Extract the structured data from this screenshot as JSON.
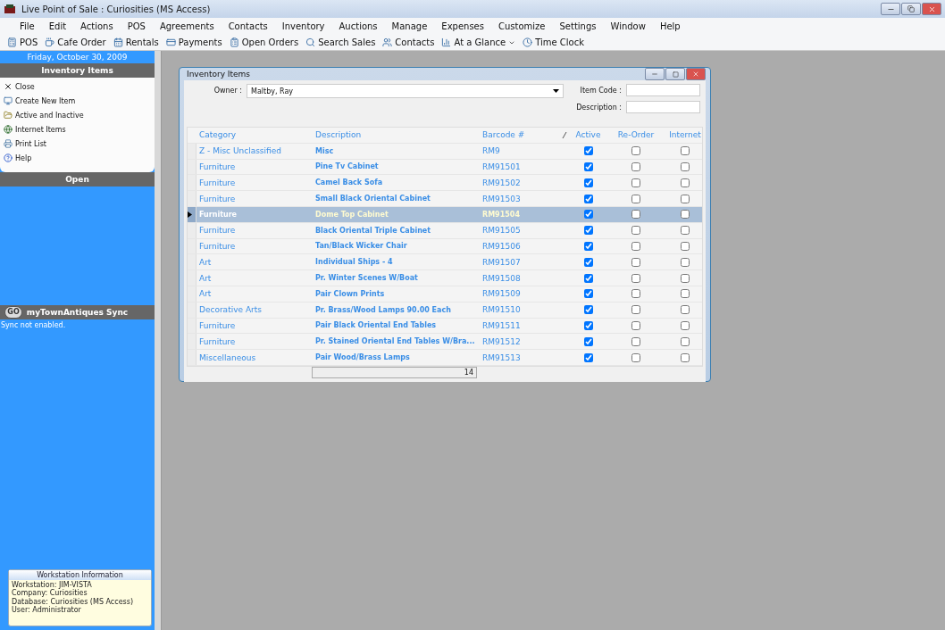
{
  "window": {
    "title": "Live Point of Sale : Curiosities (MS Access)"
  },
  "menu": [
    "File",
    "Edit",
    "Actions",
    "POS",
    "Agreements",
    "Contacts",
    "Inventory",
    "Auctions",
    "Manage",
    "Expenses",
    "Customize",
    "Settings",
    "Window",
    "Help"
  ],
  "toolbar": [
    {
      "label": "POS",
      "dropdown": false
    },
    {
      "label": "Cafe Order",
      "dropdown": false
    },
    {
      "label": "Rentals",
      "dropdown": false
    },
    {
      "label": "Payments",
      "dropdown": false
    },
    {
      "label": "Open Orders",
      "dropdown": false
    },
    {
      "label": "Search Sales",
      "dropdown": false
    },
    {
      "label": "Contacts",
      "dropdown": false
    },
    {
      "label": "At a Glance",
      "dropdown": true
    },
    {
      "label": "Time Clock",
      "dropdown": false
    }
  ],
  "sidebar": {
    "date": "Friday, October 30, 2009",
    "section": "Inventory Items",
    "actions": [
      {
        "label": "Close"
      },
      {
        "label": "Create New Item"
      },
      {
        "label": "Active and Inactive"
      },
      {
        "label": "Internet Items"
      },
      {
        "label": "Print List"
      },
      {
        "label": "Help"
      }
    ],
    "open_header": "Open",
    "sync": {
      "button": "GO",
      "title": "myTownAntiques Sync",
      "status": "Sync not enabled."
    },
    "workstation": {
      "title": "Workstation Information",
      "lines": [
        "Workstation: JIM-VISTA",
        "Company: Curiosities",
        "Database: Curiosities (MS Access)",
        "User: Administrator"
      ]
    }
  },
  "inventory_window": {
    "title": "Inventory Items",
    "owner_label": "Owner :",
    "owner_value": "Maltby, Ray",
    "item_code_label": "Item Code :",
    "description_label": "Description :",
    "columns": [
      "Category",
      "Description",
      "Barcode #",
      "Active",
      "Re-Order",
      "Internet"
    ],
    "rows": [
      {
        "category": "Z - Misc Unclassified",
        "description": "Misc",
        "barcode": "RM9",
        "active": true,
        "reorder": false,
        "internet": false,
        "selected": false
      },
      {
        "category": "Furniture",
        "description": "Pine Tv Cabinet",
        "barcode": "RM91501",
        "active": true,
        "reorder": false,
        "internet": false,
        "selected": false
      },
      {
        "category": "Furniture",
        "description": "Camel Back Sofa",
        "barcode": "RM91502",
        "active": true,
        "reorder": false,
        "internet": false,
        "selected": false
      },
      {
        "category": "Furniture",
        "description": "Small Black Oriental Cabinet",
        "barcode": "RM91503",
        "active": true,
        "reorder": false,
        "internet": false,
        "selected": false
      },
      {
        "category": "Furniture",
        "description": "Dome Top Cabinet",
        "barcode": "RM91504",
        "active": true,
        "reorder": false,
        "internet": false,
        "selected": true
      },
      {
        "category": "Furniture",
        "description": "Black Oriental Triple Cabinet",
        "barcode": "RM91505",
        "active": true,
        "reorder": false,
        "internet": false,
        "selected": false
      },
      {
        "category": "Furniture",
        "description": "Tan/Black Wicker Chair",
        "barcode": "RM91506",
        "active": true,
        "reorder": false,
        "internet": false,
        "selected": false
      },
      {
        "category": "Art",
        "description": "Individual Ships - 4",
        "barcode": "RM91507",
        "active": true,
        "reorder": false,
        "internet": false,
        "selected": false
      },
      {
        "category": "Art",
        "description": "Pr. Winter Scenes W/Boat",
        "barcode": "RM91508",
        "active": true,
        "reorder": false,
        "internet": false,
        "selected": false
      },
      {
        "category": "Art",
        "description": "Pair Clown Prints",
        "barcode": "RM91509",
        "active": true,
        "reorder": false,
        "internet": false,
        "selected": false
      },
      {
        "category": "Decorative Arts",
        "description": "Pr. Brass/Wood Lamps 90.00 Each",
        "barcode": "RM91510",
        "active": true,
        "reorder": false,
        "internet": false,
        "selected": false
      },
      {
        "category": "Furniture",
        "description": "Pair Black Oriental End Tables",
        "barcode": "RM91511",
        "active": true,
        "reorder": false,
        "internet": false,
        "selected": false
      },
      {
        "category": "Furniture",
        "description": "Pr. Stained Oriental End Tables W/Bra...",
        "barcode": "RM91512",
        "active": true,
        "reorder": false,
        "internet": false,
        "selected": false
      },
      {
        "category": "Miscellaneous",
        "description": "Pair Wood/Brass Lamps",
        "barcode": "RM91513",
        "active": true,
        "reorder": false,
        "internet": false,
        "selected": false
      }
    ],
    "count": "14"
  }
}
